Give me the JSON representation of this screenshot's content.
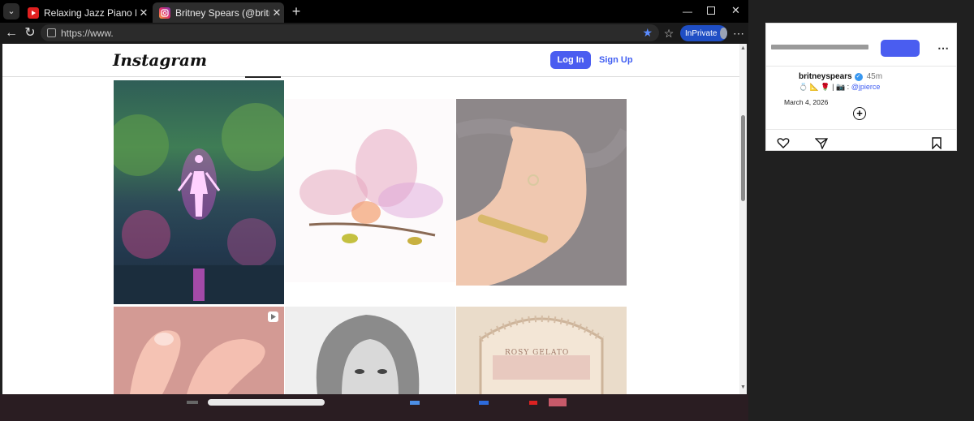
{
  "browser": {
    "tabs": [
      {
        "title": "Relaxing Jazz Piano Radio - Slow J",
        "icon": "youtube-icon",
        "active": false
      },
      {
        "title": "Britney Spears (@britneyspears) - I",
        "icon": "instagram-icon",
        "active": true
      }
    ],
    "new_tab": "+",
    "url": "https://www.",
    "inprivate_label": "InPrivate"
  },
  "instagram": {
    "logo": "Instagram",
    "login": "Log In",
    "signup": "Sign Up",
    "tiles": [
      {
        "desc": "glowing-figure-forest"
      },
      {
        "desc": "watercolor-flower"
      },
      {
        "desc": "baby-hand-ring"
      },
      {
        "desc": "fingers-video"
      },
      {
        "desc": "portrait-long-hair"
      },
      {
        "desc": "rosy-gelato-storefront",
        "sign": "ROSY GELATO"
      }
    ]
  },
  "side_panel": {
    "username": "britneyspears",
    "time": "45m",
    "caption_prefix": "💍 📐 🌹 | 📷 :",
    "caption_mention": "@jpierce",
    "date": "March 4, 2026"
  },
  "colors": {
    "accent": "#4a5df0",
    "link": "#3f5df2",
    "verified": "#3897f0"
  }
}
